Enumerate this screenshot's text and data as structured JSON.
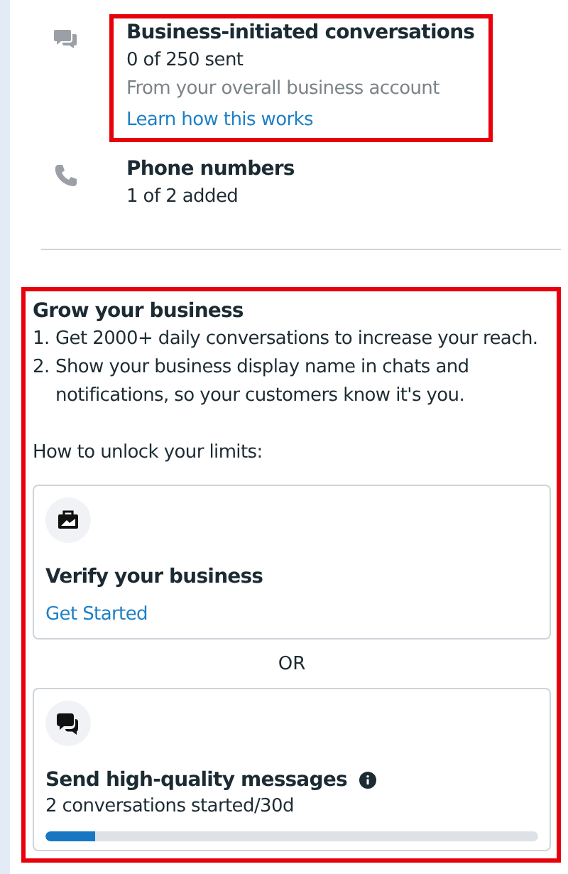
{
  "limits": [
    {
      "kind": "conversations",
      "title": "Business-initiated conversations",
      "count": "0 of 250 sent",
      "note": "From your overall business account",
      "link": "Learn how this works",
      "highlighted": true
    },
    {
      "kind": "phone",
      "title": "Phone numbers",
      "count": "1 of 2 added",
      "highlighted": false
    }
  ],
  "grow": {
    "highlighted": true,
    "title": "Grow your business",
    "points": [
      {
        "marker": "1.",
        "text": "Get 2000+ daily conversations to increase your reach."
      },
      {
        "marker": "2.",
        "text": "Show your business display name in chats and notifications, so your customers know it's you."
      }
    ],
    "unlock_label": "How to unlock your limits:",
    "options": [
      {
        "kind": "verify",
        "title": "Verify your business",
        "link": "Get Started"
      },
      {
        "kind": "quality",
        "title": "Send high-quality messages",
        "info": true,
        "progress_text": "2 conversations started/30d",
        "level": 0.1
      }
    ],
    "separator": "OR"
  }
}
